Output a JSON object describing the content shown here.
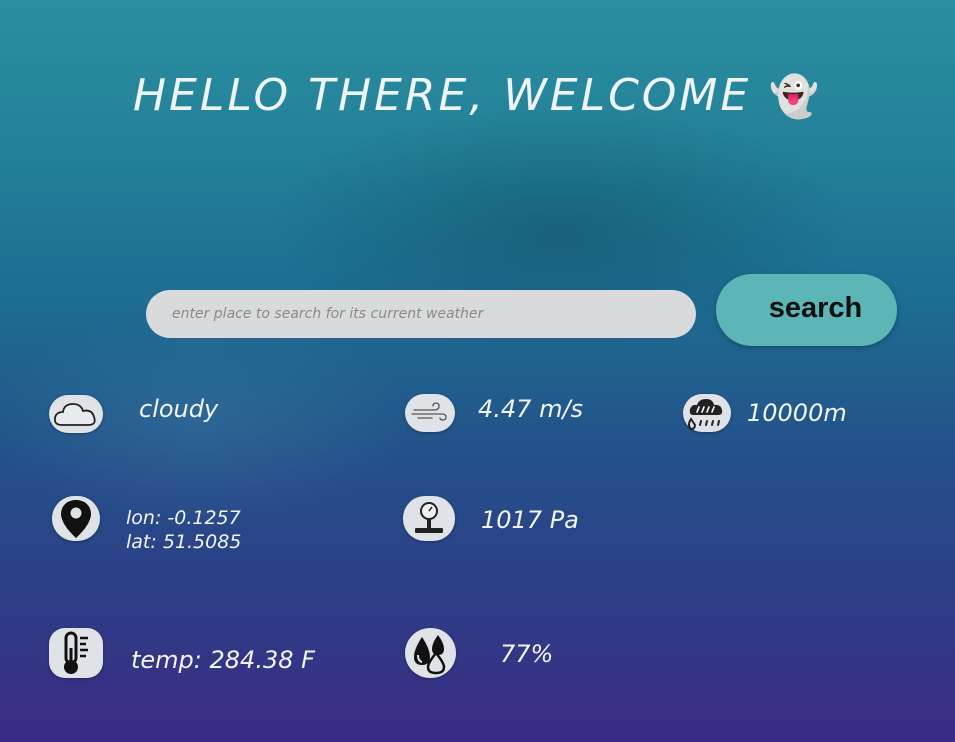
{
  "header": {
    "title": "HELLO THERE, WELCOME",
    "emoji": "👻"
  },
  "search": {
    "placeholder": "enter place to search for its current weather",
    "value": "",
    "button_label": "search"
  },
  "weather": {
    "condition": "cloudy",
    "wind_speed": "4.47 m/s",
    "visibility": "10000m",
    "lon": "lon: -0.1257",
    "lat": "lat: 51.5085",
    "pressure": "1017 Pa",
    "temp": "temp: 284.38 F",
    "humidity": "77%"
  },
  "icons": {
    "condition": "cloud-icon",
    "wind": "wind-icon",
    "visibility": "rain-visibility-icon",
    "location": "map-pin-icon",
    "pressure": "pressure-gauge-icon",
    "temp": "thermometer-icon",
    "humidity": "water-drops-icon"
  },
  "colors": {
    "button": "#5cb6b6",
    "input": "#d9dadb",
    "icon_bg": "#dfe2e6",
    "text": "#f2f4f8"
  }
}
